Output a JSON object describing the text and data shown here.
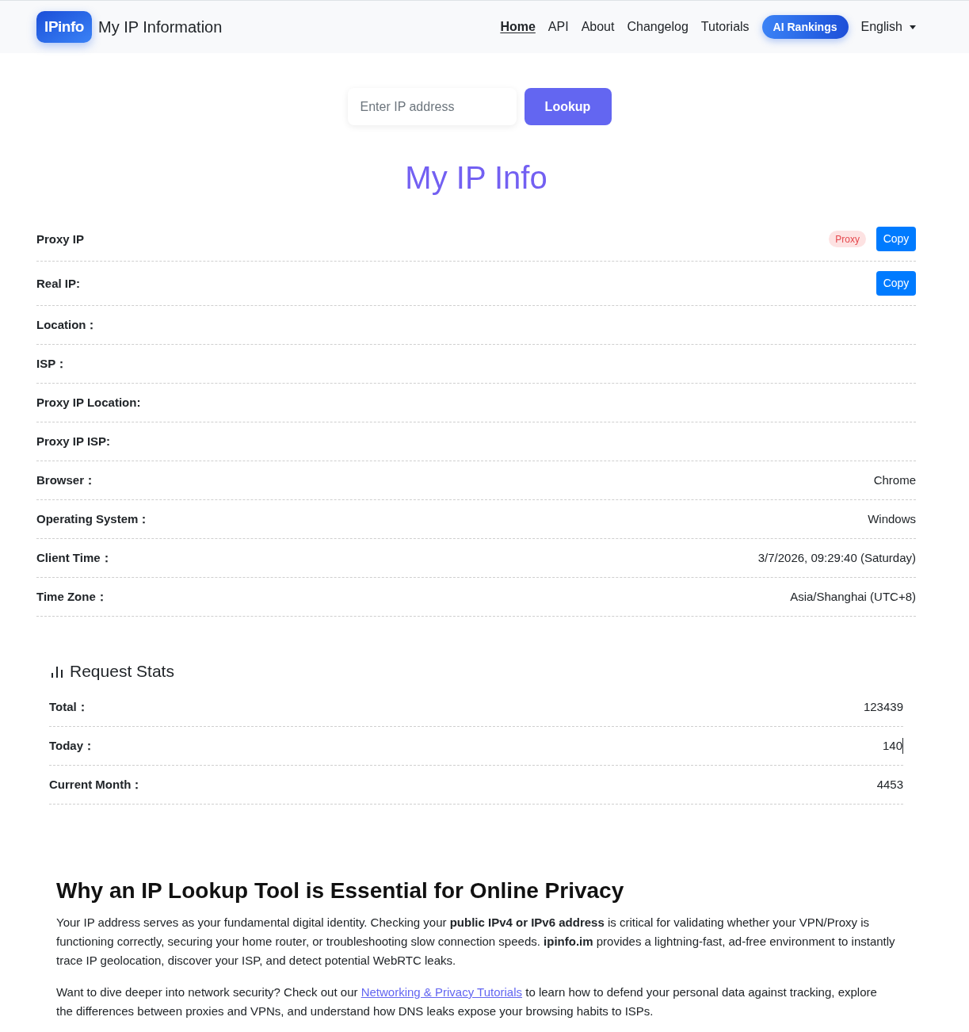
{
  "header": {
    "logo": "IPinfo",
    "title": "My IP Information",
    "nav": [
      {
        "label": "Home",
        "selected": true
      },
      {
        "label": "API",
        "selected": false
      },
      {
        "label": "About",
        "selected": false
      },
      {
        "label": "Changelog",
        "selected": false
      },
      {
        "label": "Tutorials",
        "selected": false
      }
    ],
    "highlight_button": "AI Rankings",
    "language": "English"
  },
  "search": {
    "placeholder": "Enter IP address",
    "button": "Lookup"
  },
  "title": "My IP Info",
  "info_rows": [
    {
      "label": "Proxy IP",
      "badge": "Proxy",
      "copy_button": "Copy"
    },
    {
      "label": "Real IP:",
      "copy_button": "Copy"
    },
    {
      "label": "Location："
    },
    {
      "label": "ISP："
    },
    {
      "label": "Proxy IP Location:"
    },
    {
      "label": "Proxy IP ISP:"
    },
    {
      "label": "Browser：",
      "value": "Chrome"
    },
    {
      "label": "Operating System：",
      "value": "Windows"
    },
    {
      "label": "Client Time：",
      "value": "3/7/2026, 09:29:40 (Saturday)"
    },
    {
      "label": "Time Zone：",
      "value": "Asia/Shanghai (UTC+8)"
    }
  ],
  "stats": {
    "title": "Request Stats",
    "rows": [
      {
        "label": "Total：",
        "value": "123439",
        "focused": false
      },
      {
        "label": "Today：",
        "value": "140",
        "focused": true
      },
      {
        "label": "Current Month：",
        "value": "4453",
        "focused": false
      }
    ]
  },
  "article": {
    "heading": "Why an IP Lookup Tool is Essential for Online Privacy",
    "paragraph": "Your IP address serves as your fundamental digital identity. Checking your **public IPv4 or IPv6 address** is critical for validating whether your VPN/Proxy is functioning correctly, securing your home router, or troubleshooting slow connection speeds. **ipinfo.im** provides a lightning-fast, ad-free environment to instantly trace IP geolocation, discover your ISP, and detect potential WebRTC leaks.",
    "cta": {
      "before": "Want to dive deeper into network security? Check out our ",
      "link": "Networking & Privacy Tutorials",
      "after": " to learn how to defend your personal data against tracking, explore the differences between proxies and VPNs, and understand how DNS leaks expose your browsing habits to ISPs."
    }
  }
}
